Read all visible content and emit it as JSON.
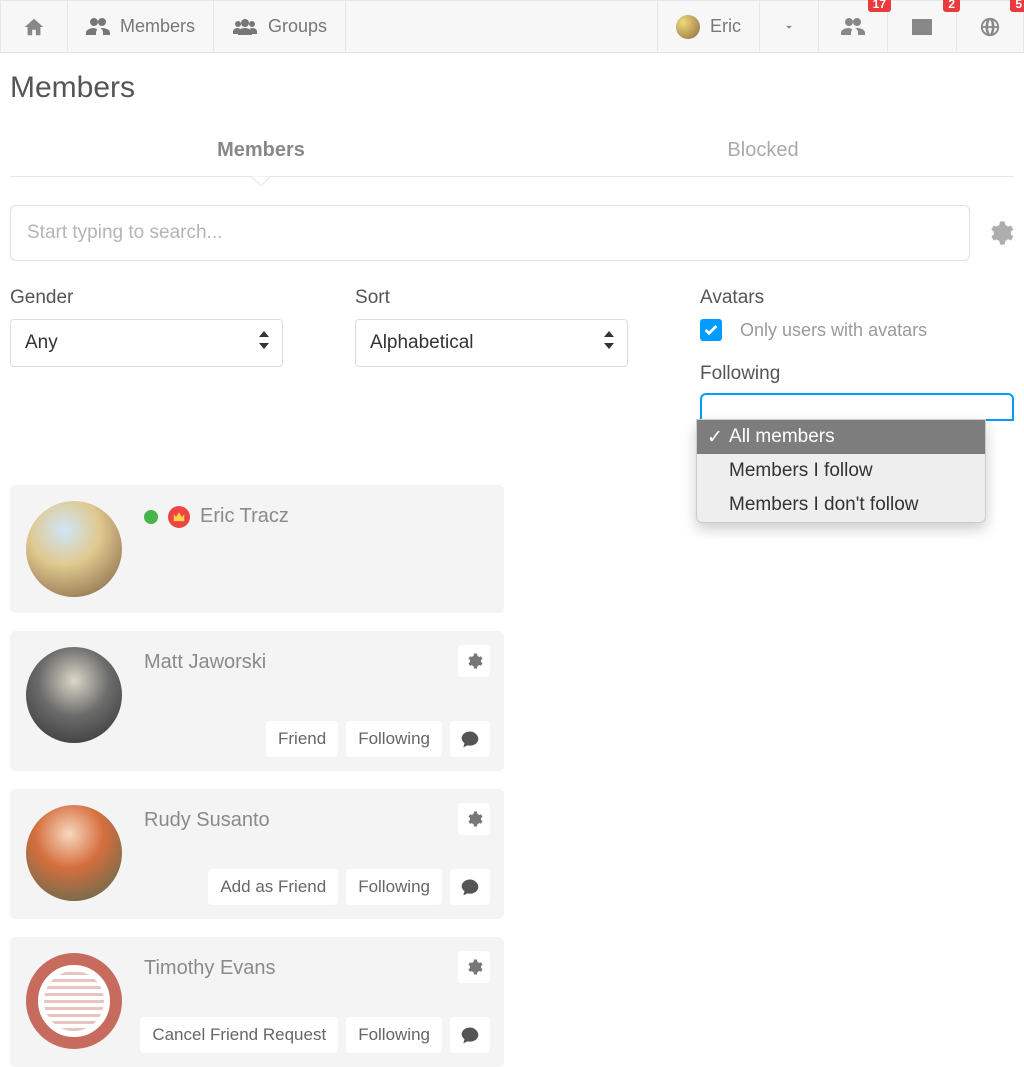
{
  "nav": {
    "members": "Members",
    "groups": "Groups",
    "user": "Eric",
    "badges": {
      "friends": "17",
      "messages": "2",
      "notifications": "5"
    }
  },
  "page_title": "Members",
  "tabs": {
    "members": "Members",
    "blocked": "Blocked"
  },
  "search": {
    "placeholder": "Start typing to search..."
  },
  "filters": {
    "gender_label": "Gender",
    "gender_value": "Any",
    "sort_label": "Sort",
    "sort_value": "Alphabetical",
    "avatars_label": "Avatars",
    "avatars_check_label": "Only users with avatars",
    "following_label": "Following",
    "following_options": [
      "All members",
      "Members I follow",
      "Members I don't follow"
    ],
    "following_selected": "All members"
  },
  "members": [
    {
      "name": "Eric Tracz",
      "online": true,
      "crown": true,
      "gear": false,
      "actions": []
    },
    {
      "name": "Matt Jaworski",
      "online": false,
      "crown": false,
      "gear": true,
      "actions": [
        "Friend",
        "Following"
      ],
      "chat": true
    },
    {
      "name": "Rudy Susanto",
      "online": false,
      "crown": false,
      "gear": true,
      "actions": [
        "Add as Friend",
        "Following"
      ],
      "chat": true
    },
    {
      "name": "Timothy Evans",
      "online": false,
      "crown": false,
      "gear": true,
      "actions": [
        "Cancel Friend Request",
        "Following"
      ],
      "chat": true
    }
  ]
}
